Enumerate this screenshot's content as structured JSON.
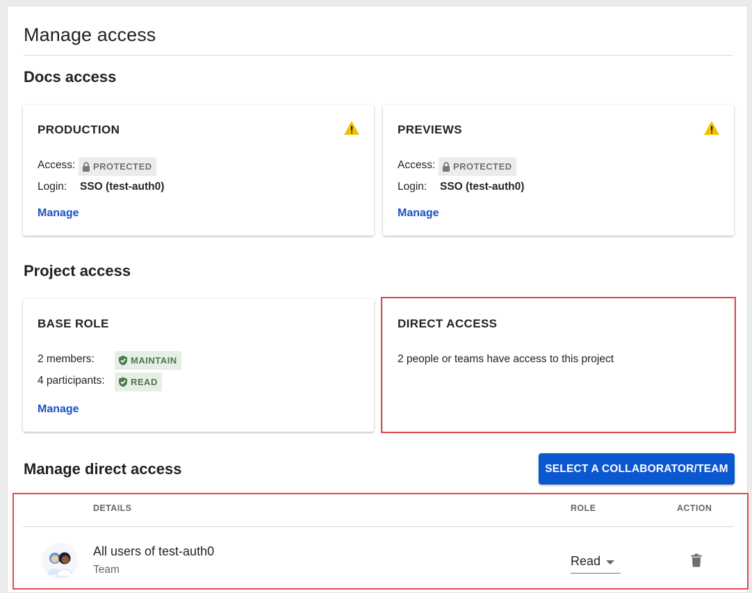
{
  "page": {
    "title": "Manage access"
  },
  "docs_access": {
    "title": "Docs access",
    "cards": [
      {
        "title": "PRODUCTION",
        "warning_icon": "warning-triangle-icon",
        "access_label": "Access:",
        "access_badge": "PROTECTED",
        "login_label": "Login:",
        "login_value": "SSO (test-auth0)",
        "manage_label": "Manage"
      },
      {
        "title": "PREVIEWS",
        "warning_icon": "warning-triangle-icon",
        "access_label": "Access:",
        "access_badge": "PROTECTED",
        "login_label": "Login:",
        "login_value": "SSO (test-auth0)",
        "manage_label": "Manage"
      }
    ]
  },
  "project_access": {
    "title": "Project access",
    "base_role": {
      "title": "BASE ROLE",
      "members_label": "2 members:",
      "members_badge": "MAINTAIN",
      "participants_label": "4 participants:",
      "participants_badge": "READ",
      "manage_label": "Manage"
    },
    "direct_access": {
      "title": "DIRECT ACCESS",
      "text": "2 people or teams have access to this project"
    }
  },
  "manage_direct_access": {
    "title": "Manage direct access",
    "select_button": "SELECT A COLLABORATOR/TEAM",
    "columns": {
      "details": "DETAILS",
      "role": "ROLE",
      "action": "ACTION"
    },
    "rows": [
      {
        "name": "All users of test-auth0",
        "type": "Team",
        "role": "Read",
        "action_icon": "trash-icon"
      }
    ]
  },
  "colors": {
    "primary": "#0b57d0",
    "link": "#1a51c5",
    "warning": "#f2c200",
    "highlight_border": "#e0474c",
    "badge_green_text": "#4c7a4c"
  }
}
